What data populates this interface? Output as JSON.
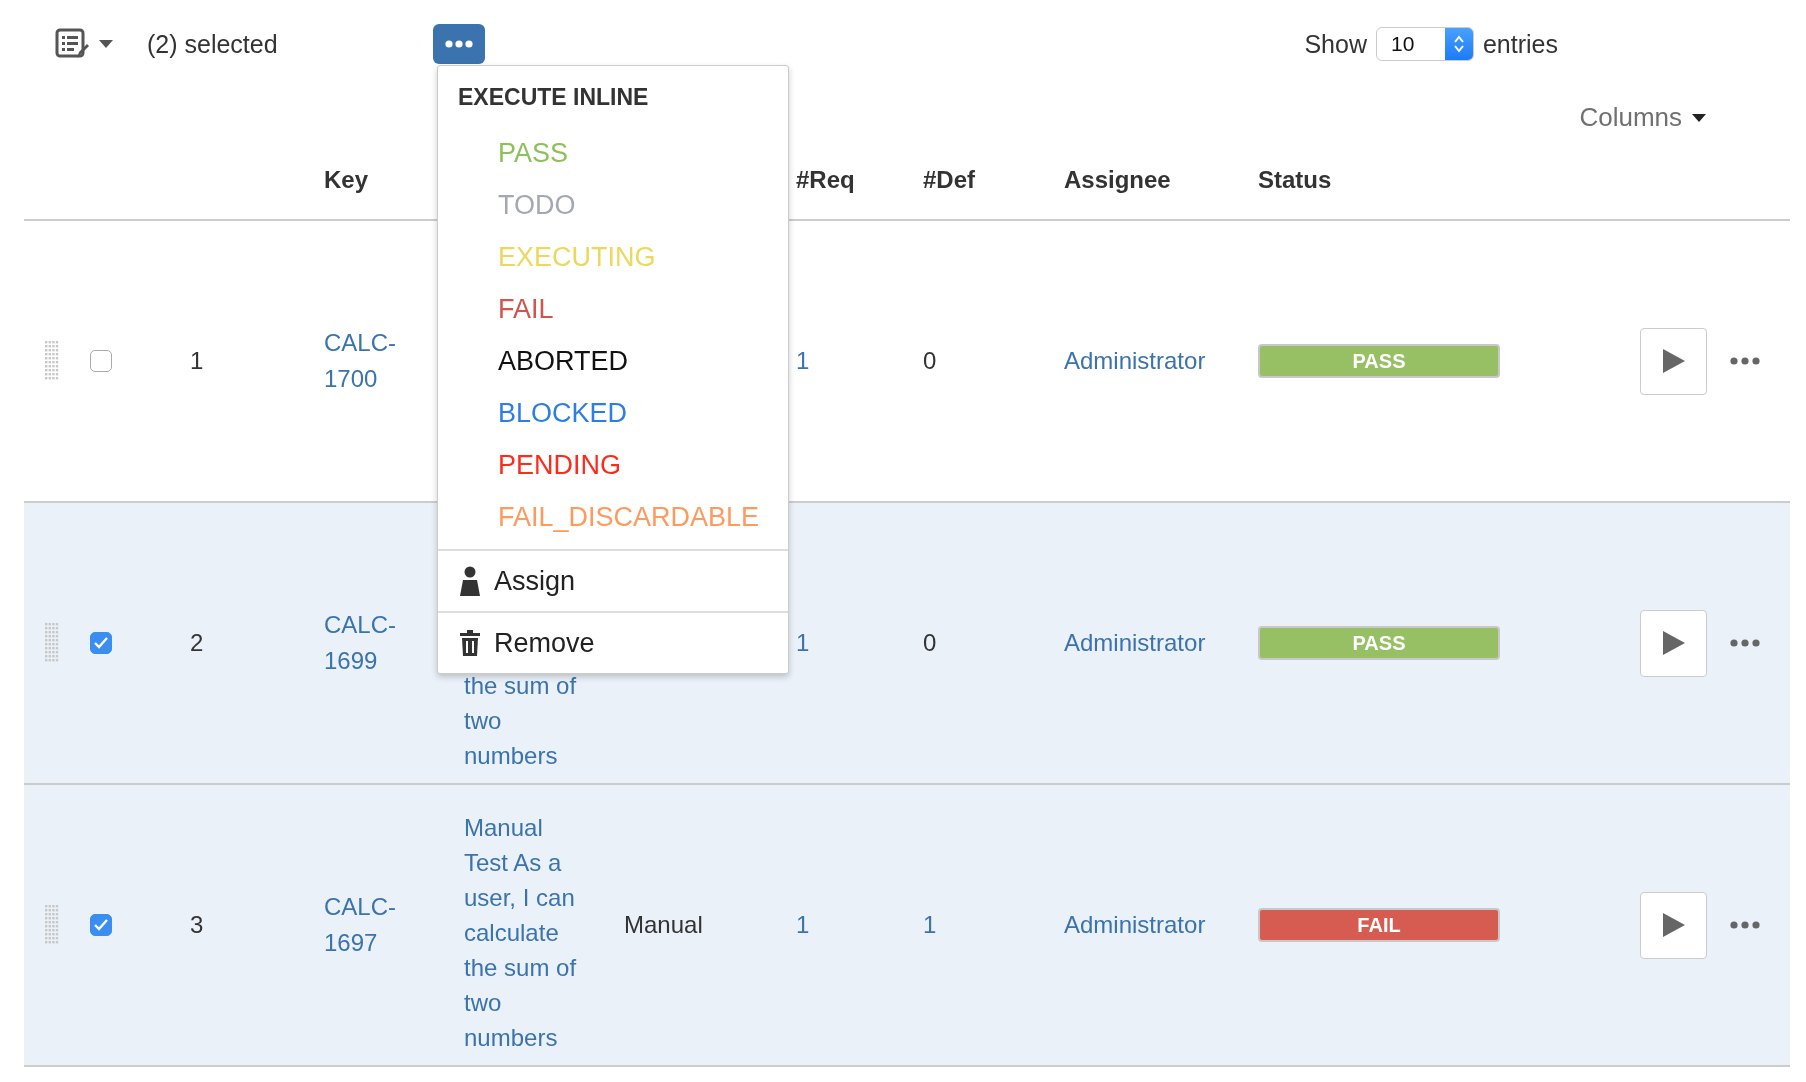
{
  "toolbar": {
    "selected_count": "(2) selected",
    "show_label": "Show",
    "page_size": "10",
    "entries_label": "entries",
    "columns_button": "Columns"
  },
  "actions_menu": {
    "heading": "EXECUTE INLINE",
    "statuses": [
      {
        "label": "PASS",
        "color": "#8dc05a"
      },
      {
        "label": "TODO",
        "color": "#a4a8b5"
      },
      {
        "label": "EXECUTING",
        "color": "#ecd85c"
      },
      {
        "label": "FAIL",
        "color": "#d0554c"
      },
      {
        "label": "ABORTED",
        "color": "#111111"
      },
      {
        "label": "BLOCKED",
        "color": "#2b7de9"
      },
      {
        "label": "PENDING",
        "color": "#ff2a1a"
      },
      {
        "label": "FAIL_DISCARDABLE",
        "color": "#ff9a5c"
      }
    ],
    "actions": [
      {
        "kind": "assign",
        "label": "Assign"
      },
      {
        "kind": "remove",
        "label": "Remove"
      }
    ]
  },
  "table": {
    "columns": [
      {
        "kind": "key",
        "label": "Key"
      },
      {
        "kind": "req",
        "label": "#Req"
      },
      {
        "kind": "def",
        "label": "#Def"
      },
      {
        "kind": "assignee",
        "label": "Assignee"
      },
      {
        "kind": "status",
        "label": "Status"
      }
    ],
    "rows": [
      {
        "checked": false,
        "number": "1",
        "key": "CALC-1700",
        "req": "1",
        "def": {
          "text": "0",
          "link": false
        },
        "assignee": "Administrator",
        "status": {
          "label": "PASS",
          "color": "#97c064"
        }
      },
      {
        "checked": true,
        "number": "2",
        "key": "CALC-1699",
        "summary": "the sum of two numbers",
        "req": "1",
        "def": {
          "text": "0",
          "link": false
        },
        "assignee": "Administrator",
        "status": {
          "label": "PASS",
          "color": "#97c064"
        }
      },
      {
        "checked": true,
        "number": "3",
        "key": "CALC-1697",
        "summary": "Manual Test As a user, I can calculate the sum of two numbers",
        "type": "Manual",
        "req": "1",
        "def": {
          "text": "1",
          "link": true
        },
        "assignee": "Administrator",
        "status": {
          "label": "FAIL",
          "color": "#d65b50"
        }
      }
    ]
  }
}
